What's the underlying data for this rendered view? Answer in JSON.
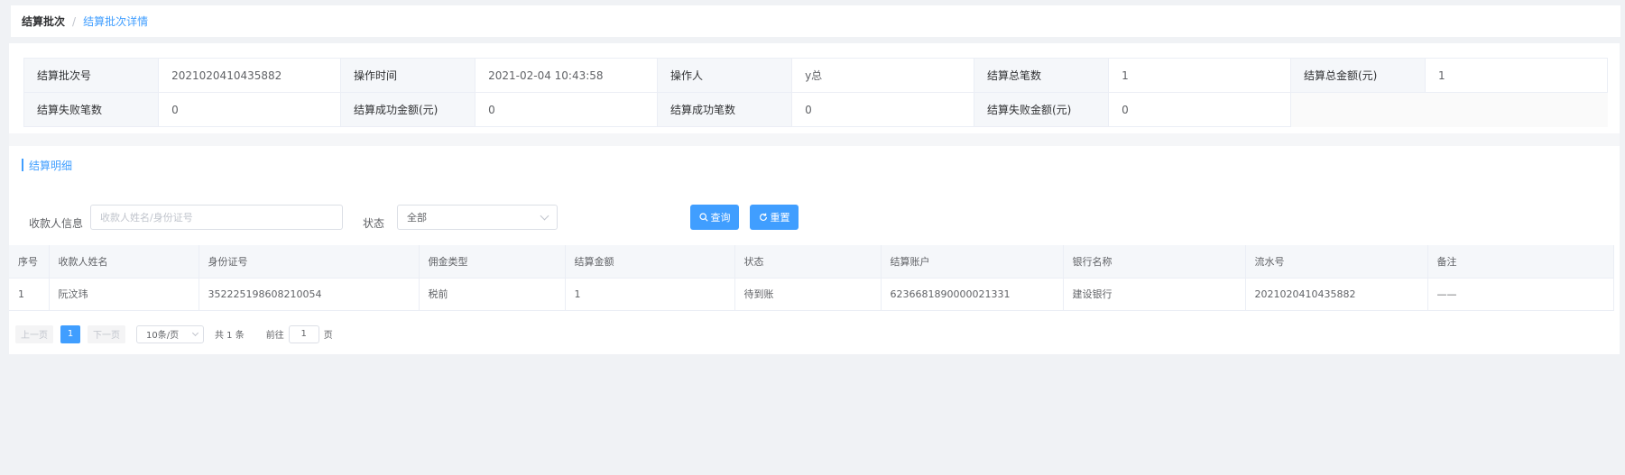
{
  "breadcrumb": {
    "parent": "结算批次",
    "separator": "/",
    "current": "结算批次详情"
  },
  "summary": {
    "row1": [
      {
        "label": "结算批次号",
        "value": "2021020410435882"
      },
      {
        "label": "操作时间",
        "value": "2021-02-04 10:43:58"
      },
      {
        "label": "操作人",
        "value": "y总"
      },
      {
        "label": "结算总笔数",
        "value": "1"
      },
      {
        "label": "结算总金额(元)",
        "value": "1"
      }
    ],
    "row2": [
      {
        "label": "结算失败笔数",
        "value": "0"
      },
      {
        "label": "结算成功金额(元)",
        "value": "0"
      },
      {
        "label": "结算成功笔数",
        "value": "0"
      },
      {
        "label": "结算失败金额(元)",
        "value": "0"
      }
    ]
  },
  "section": {
    "title": "结算明细"
  },
  "filters": {
    "payee_label": "收款人信息",
    "payee_placeholder": "收款人姓名/身份证号",
    "status_label": "状态",
    "status_value": "全部",
    "search_label": "查询",
    "reset_label": "重置"
  },
  "table": {
    "columns": [
      "序号",
      "收款人姓名",
      "身份证号",
      "佣金类型",
      "结算金额",
      "状态",
      "结算账户",
      "银行名称",
      "流水号",
      "备注"
    ],
    "rows": [
      [
        "1",
        "阮汶玮",
        "352225198608210054",
        "税前",
        "1",
        "待到账",
        "6236681890000021331",
        "建设银行",
        "2021020410435882",
        "——"
      ]
    ]
  },
  "pagination": {
    "prev_label": "上一页",
    "current_page": "1",
    "next_label": "下一页",
    "page_size": "10条/页",
    "total": "共 1 条",
    "goto_prefix": "前往",
    "goto_value": "1",
    "goto_suffix": "页"
  },
  "colors": {
    "accent": "#409eff",
    "page_bg": "#f0f2f5",
    "header_bg": "#f5f7fa",
    "border": "#ebeef5"
  }
}
